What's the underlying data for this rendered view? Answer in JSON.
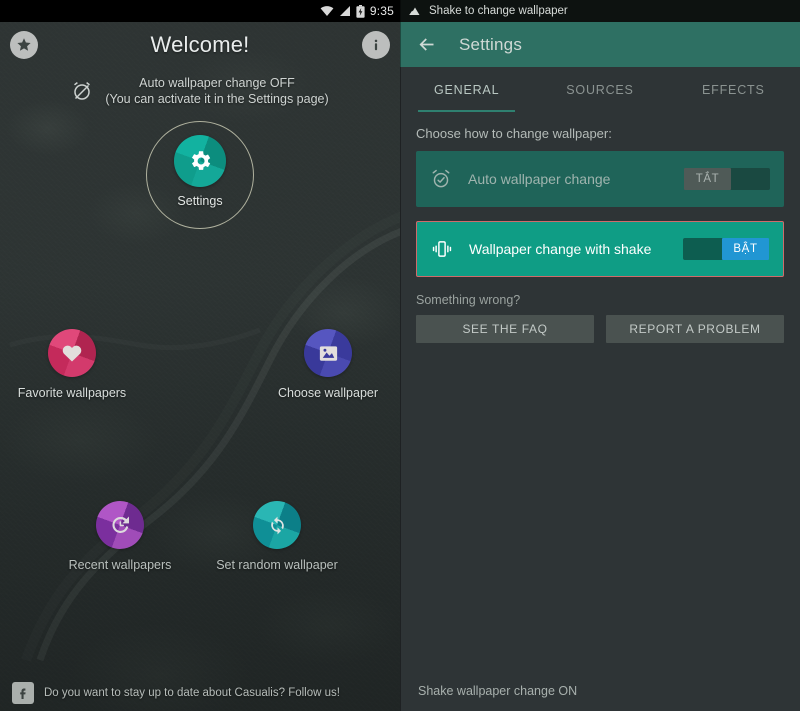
{
  "left": {
    "status_bar": {
      "time": "9:35",
      "icons": [
        "wifi-icon",
        "signal-icon",
        "battery-charging-icon"
      ]
    },
    "header": {
      "title": "Welcome!",
      "star_button": "star-icon",
      "info_button": "info-icon"
    },
    "notice": {
      "icon": "alarm-off-icon",
      "line1": "Auto wallpaper change OFF",
      "line2": "(You can activate it in the Settings page)"
    },
    "settings_circle": {
      "label": "Settings",
      "icon": "gear-icon"
    },
    "shortcuts": [
      {
        "label": "Favorite wallpapers",
        "icon": "heart-icon",
        "color": "#c42a5b"
      },
      {
        "label": "Choose wallpaper",
        "icon": "image-icon",
        "color": "#4a4ab0"
      },
      {
        "label": "Recent wallpapers",
        "icon": "history-icon",
        "color": "#8e3aad"
      },
      {
        "label": "Set random wallpaper",
        "icon": "shuffle-refresh-icon",
        "color": "#14a0a2"
      }
    ],
    "footer": {
      "icon": "facebook-icon",
      "text": "Do you want to stay up to date about Casualis? Follow us!"
    }
  },
  "right": {
    "status_bar": {
      "icon": "mountain-notification-icon",
      "text": "Shake to change wallpaper"
    },
    "toolbar": {
      "back_icon": "arrow-back-icon",
      "title": "Settings",
      "color": "#2e7063"
    },
    "tabs": [
      {
        "label": "GENERAL",
        "active": true
      },
      {
        "label": "SOURCES",
        "active": false
      },
      {
        "label": "EFFECTS",
        "active": false
      }
    ],
    "section_label": "Choose how to change wallpaper:",
    "options": [
      {
        "label": "Auto wallpaper change",
        "icon": "alarm-check-icon",
        "state": "off",
        "switch_text": "TẮT",
        "card_color": "#1f6459"
      },
      {
        "label": "Wallpaper change with shake",
        "icon": "vibrate-icon",
        "state": "on",
        "switch_text": "BẬT",
        "card_color": "#0f9d85",
        "highlight_color": "#cf6b6b"
      }
    ],
    "help": {
      "label": "Something wrong?",
      "buttons": [
        "SEE THE FAQ",
        "REPORT A PROBLEM"
      ]
    },
    "footer": {
      "text": "Shake wallpaper change ON"
    }
  }
}
